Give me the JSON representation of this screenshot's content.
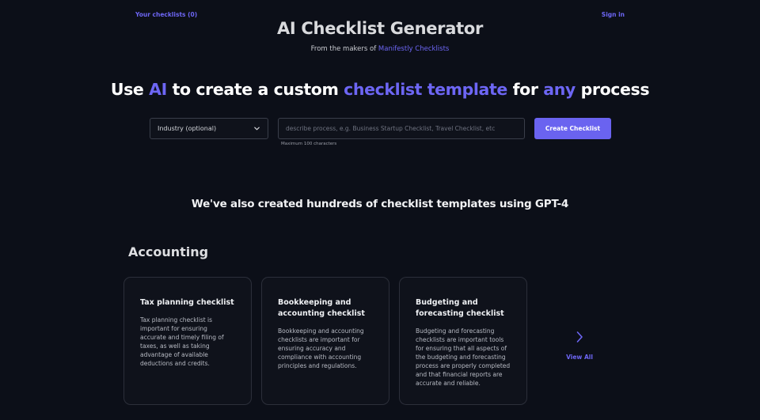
{
  "nav": {
    "your_checklists": "Your checklists (0)",
    "sign_in": "Sign in"
  },
  "header": {
    "title": "AI Checklist Generator",
    "subtitle_prefix": "From the makers of",
    "subtitle_link": "Manifestly Checklists"
  },
  "hero": {
    "part1": "Use ",
    "ai": "AI",
    "part2": " to create a custom ",
    "template": "checklist template",
    "part3": " for ",
    "any": "any",
    "part4": " process"
  },
  "form": {
    "industry_label": "Industry (optional)",
    "input_placeholder": "describe process, e.g. Business Startup Checklist, Travel Checklist, etc",
    "input_value": "",
    "max_hint": "Maximum 100 characters",
    "create_label": "Create Checklist"
  },
  "templates": {
    "heading": "We've also created hundreds of checklist templates using GPT-4",
    "category": "Accounting",
    "cards": [
      {
        "title": "Tax planning checklist",
        "description": "Tax planning checklist is important for ensuring accurate and timely filing of taxes, as well as taking advantage of available deductions and credits."
      },
      {
        "title": "Bookkeeping and accounting checklist",
        "description": "Bookkeeping and accounting checklists are important for ensuring accuracy and compliance with accounting principles and regulations."
      },
      {
        "title": "Budgeting and forecasting checklist",
        "description": "Budgeting and forecasting checklists are important tools for ensuring that all aspects of the budgeting and forecasting process are properly completed and that financial reports are accurate and reliable."
      }
    ],
    "view_all": "View All"
  },
  "colors": {
    "background": "#0c0f18",
    "accent": "#6d66f4",
    "button": "#6a63f0"
  },
  "icons": {
    "select_chevron": "chevron-down-icon",
    "view_all_arrow": "chevron-right-icon"
  }
}
